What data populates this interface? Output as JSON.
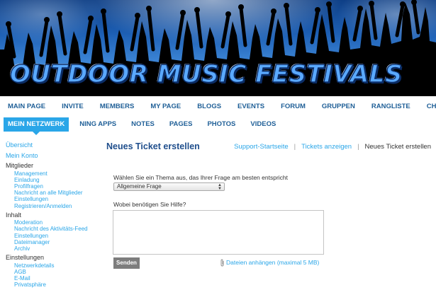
{
  "banner": {
    "title": "OUTDOOR MUSIC FESTIVALS"
  },
  "nav": {
    "row1": [
      "MAIN PAGE",
      "INVITE",
      "MEMBERS",
      "MY PAGE",
      "BLOGS",
      "EVENTS",
      "FORUM",
      "GRUPPEN",
      "RANGLISTE",
      "CHAT"
    ],
    "row2": [
      "MEIN NETZWERK",
      "NING APPS",
      "NOTES",
      "PAGES",
      "PHOTOS",
      "VIDEOS"
    ],
    "active": "MEIN NETZWERK"
  },
  "sidebar": {
    "overview": "Übersicht",
    "account": "Mein Konto",
    "groups": [
      {
        "heading": "Mitglieder",
        "items": [
          "Management",
          "Einladung",
          "Profilfragen",
          "Nachricht an alle Mitglieder",
          "Einstellungen",
          "Registrieren/Anmelden"
        ]
      },
      {
        "heading": "Inhalt",
        "items": [
          "Moderation",
          "Nachricht des Aktivitäts-Feed",
          "Einstellungen",
          "Dateimanager",
          "Archiv"
        ]
      },
      {
        "heading": "Einstellungen",
        "items": [
          "Netzwerkdetails",
          "AGB",
          "E-Mail",
          "Privatsphäre"
        ]
      }
    ]
  },
  "main": {
    "title": "Neues Ticket erstellen",
    "breadcrumb": {
      "support_home": "Support-Startseite",
      "show_tickets": "Tickets anzeigen",
      "current": "Neues Ticket erstellen"
    },
    "topic_label": "Wählen Sie ein Thema aus, das Ihrer Frage am besten entspricht",
    "topic_selected": "Allgemeine Frage",
    "help_label": "Wobei benötigen Sie Hilfe?",
    "help_value": "",
    "send_label": "Senden",
    "attach_label": "Dateien anhängen (maximal 5 MB)"
  },
  "colors": {
    "link": "#2aa6e8",
    "nav_text": "#1f5f97",
    "title": "#1f4e8c",
    "active_tab": "#2aa6e8",
    "button": "#7d7d7d"
  }
}
